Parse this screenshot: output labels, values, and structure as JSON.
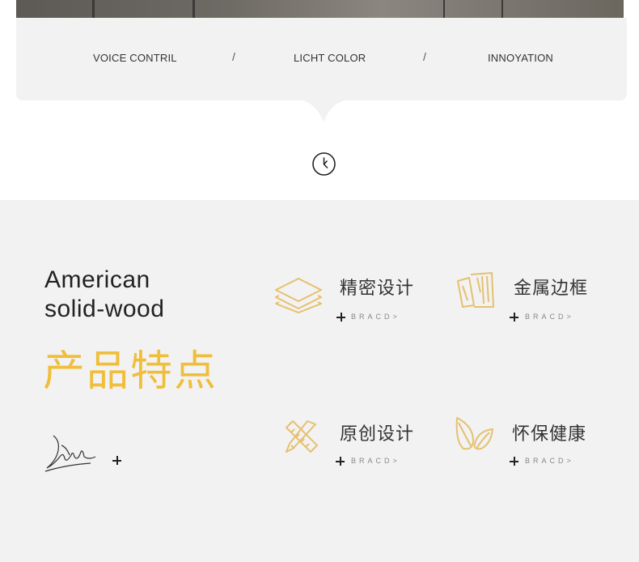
{
  "features": {
    "items": [
      "VOICE CONTRIL",
      "LICHT COLOR",
      "INNOYATION"
    ],
    "separator": "/"
  },
  "intro": {
    "line1": "American",
    "line2": "solid-wood",
    "title_cn": "产品特点"
  },
  "items": [
    {
      "title": "精密设计",
      "sub": "BRACD>",
      "icon": "layers-icon"
    },
    {
      "title": "金属边框",
      "sub": "BRACD>",
      "icon": "wood-panel-icon"
    },
    {
      "title": "原创设计",
      "sub": "BRACD>",
      "icon": "pencil-ruler-icon"
    },
    {
      "title": "怀保健康",
      "sub": "BRACD>",
      "icon": "leaves-icon"
    }
  ],
  "colors": {
    "accent": "#f0be3a",
    "icon_gold": "#e6c070",
    "band": "#f2f2f2"
  }
}
